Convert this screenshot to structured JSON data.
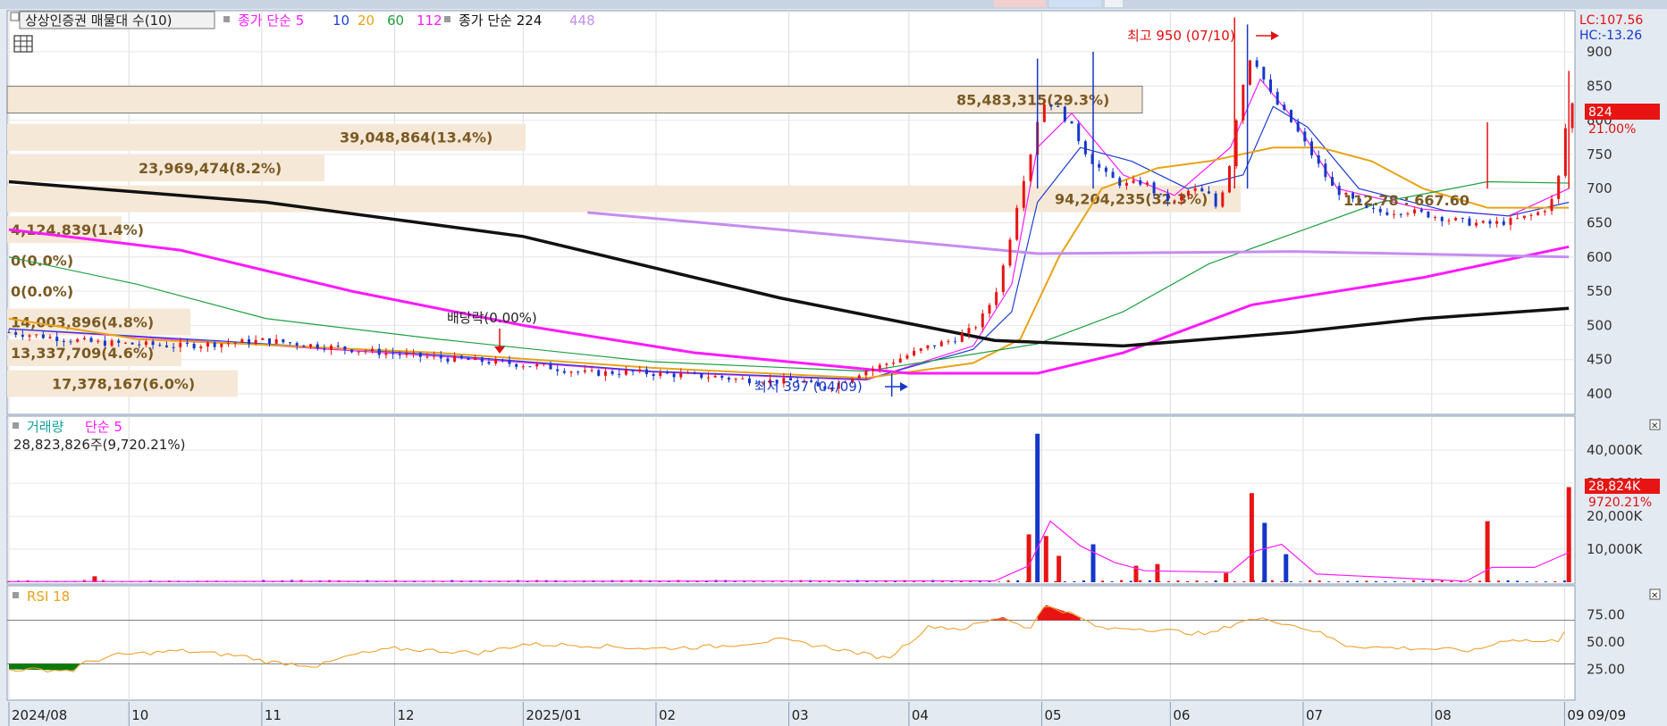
{
  "main_panel": {
    "indicator_title": "상상인증권 매물대 수(10)",
    "ma_label": "종가 단순 5",
    "ma_periods": [
      {
        "text": "10",
        "color": "#1f3fd6"
      },
      {
        "text": "20",
        "color": "#e8a317"
      },
      {
        "text": "60",
        "color": "#20a040"
      },
      {
        "text": "112",
        "color": "#ff1aff"
      }
    ],
    "ma2_label": "종가 단순 224",
    "ma2_period": "448",
    "high_marker": "최고 950 (07/10)",
    "low_marker": "최저 397 (04/09)",
    "dividend_marker": "배당락(0.00%)",
    "lc_label": "LC:107.56",
    "hc_label": "HC:-13.26",
    "current_price": "824",
    "current_change": "21.00%"
  },
  "volume_profile": [
    {
      "label": "85,483,315(29.3%)",
      "price": 830,
      "width": 1270,
      "highlight": true
    },
    {
      "label": "39,048,864(13.4%)",
      "price": 775,
      "width": 580
    },
    {
      "label": "23,969,474(8.2%)",
      "price": 730,
      "width": 355
    },
    {
      "label": "94,204,235(32.3%)",
      "price": 685,
      "width": 1380
    },
    {
      "label": "4,124,839(1.4%)",
      "price": 640,
      "width": 128
    },
    {
      "label": "0(0.0%)",
      "price": 595,
      "width": 0
    },
    {
      "label": "0(0.0%)",
      "price": 550,
      "width": 0
    },
    {
      "label": "14,003,896(4.8%)",
      "price": 505,
      "width": 205
    },
    {
      "label": "13,337,709(4.6%)",
      "price": 460,
      "width": 195
    },
    {
      "label": "17,378,167(6.0%)",
      "price": 415,
      "width": 258
    }
  ],
  "overlay_label": "112.78 : 667.60",
  "volume_panel": {
    "title": "거래량",
    "ma_label": "단순 5",
    "value_text": "28,823,826주(9,720.21%)",
    "current_volume": "28,824K",
    "current_change": "9720.21%"
  },
  "rsi_panel": {
    "title": "RSI 18"
  },
  "x_axis": {
    "labels": [
      "2024/08",
      "10",
      "11",
      "12",
      "2025/01",
      "02",
      "03",
      "04",
      "05",
      "06",
      "07",
      "08",
      "09",
      "09/09"
    ]
  },
  "chart_data": [
    {
      "type": "candlestick",
      "y_ticks": [
        "400",
        "450",
        "500",
        "550",
        "600",
        "650",
        "700",
        "750",
        "800",
        "850",
        "900"
      ],
      "ylim": [
        370,
        960
      ],
      "months": [
        "2024/08",
        "10",
        "11",
        "12",
        "2025/01",
        "02",
        "03",
        "04",
        "05",
        "06",
        "07",
        "08",
        "09"
      ],
      "close_path": [
        [
          0,
          490
        ],
        [
          20,
          475
        ],
        [
          40,
          470
        ],
        [
          60,
          478
        ],
        [
          80,
          465
        ],
        [
          95,
          455
        ],
        [
          110,
          448
        ],
        [
          125,
          440
        ],
        [
          135,
          430
        ],
        [
          145,
          432
        ],
        [
          155,
          428
        ],
        [
          165,
          425
        ],
        [
          170,
          421
        ],
        [
          175,
          420
        ],
        [
          180,
          418
        ],
        [
          185,
          420
        ],
        [
          188,
          410
        ],
        [
          190,
          408
        ],
        [
          193,
          414
        ],
        [
          198,
          430
        ],
        [
          203,
          440
        ],
        [
          208,
          452
        ],
        [
          212,
          462
        ],
        [
          215,
          470
        ],
        [
          220,
          478
        ],
        [
          225,
          495
        ],
        [
          228,
          520
        ],
        [
          231,
          560
        ],
        [
          234,
          640
        ],
        [
          236,
          700
        ],
        [
          238,
          740
        ],
        [
          240,
          800
        ],
        [
          242,
          830
        ],
        [
          245,
          815
        ],
        [
          248,
          790
        ],
        [
          252,
          745
        ],
        [
          256,
          720
        ],
        [
          260,
          705
        ],
        [
          265,
          710
        ],
        [
          268,
          690
        ],
        [
          272,
          680
        ],
        [
          276,
          700
        ],
        [
          280,
          690
        ],
        [
          282,
          670
        ],
        [
          285,
          740
        ],
        [
          287,
          830
        ],
        [
          290,
          900
        ],
        [
          292,
          870
        ],
        [
          295,
          830
        ],
        [
          298,
          808
        ],
        [
          300,
          790
        ],
        [
          303,
          760
        ],
        [
          306,
          730
        ],
        [
          309,
          700
        ],
        [
          313,
          685
        ],
        [
          317,
          668
        ],
        [
          321,
          665
        ],
        [
          326,
          668
        ],
        [
          331,
          662
        ],
        [
          336,
          655
        ],
        [
          341,
          650
        ],
        [
          345,
          648
        ],
        [
          350,
          652
        ],
        [
          355,
          660
        ],
        [
          358,
          668
        ],
        [
          361,
          690
        ],
        [
          364,
          824
        ]
      ],
      "high": {
        "value": 950,
        "date": "07/10"
      },
      "low": {
        "value": 397,
        "date": "04/09"
      },
      "ma_series": [
        {
          "name": "5",
          "color": "#ff1aff",
          "path": [
            [
              0,
              495
            ],
            [
              50,
              475
            ],
            [
              100,
              455
            ],
            [
              150,
              432
            ],
            [
              200,
              420
            ],
            [
              225,
              470
            ],
            [
              234,
              560
            ],
            [
              240,
              760
            ],
            [
              248,
              810
            ],
            [
              260,
              720
            ],
            [
              272,
              690
            ],
            [
              285,
              760
            ],
            [
              292,
              860
            ],
            [
              300,
              800
            ],
            [
              310,
              700
            ],
            [
              330,
              670
            ],
            [
              350,
              660
            ],
            [
              364,
              700
            ]
          ]
        },
        {
          "name": "10",
          "color": "#1f3fd6",
          "path": [
            [
              0,
              495
            ],
            [
              50,
              477
            ],
            [
              100,
              457
            ],
            [
              150,
              433
            ],
            [
              200,
              421
            ],
            [
              225,
              465
            ],
            [
              234,
              520
            ],
            [
              240,
              680
            ],
            [
              250,
              760
            ],
            [
              262,
              740
            ],
            [
              275,
              700
            ],
            [
              288,
              720
            ],
            [
              295,
              820
            ],
            [
              303,
              790
            ],
            [
              315,
              700
            ],
            [
              335,
              668
            ],
            [
              350,
              660
            ],
            [
              364,
              680
            ]
          ]
        },
        {
          "name": "20",
          "color": "#e8a317",
          "path": [
            [
              0,
              510
            ],
            [
              30,
              480
            ],
            [
              100,
              460
            ],
            [
              150,
              438
            ],
            [
              200,
              423
            ],
            [
              225,
              445
            ],
            [
              236,
              480
            ],
            [
              245,
              600
            ],
            [
              255,
              700
            ],
            [
              268,
              730
            ],
            [
              280,
              740
            ],
            [
              295,
              760
            ],
            [
              306,
              760
            ],
            [
              318,
              740
            ],
            [
              330,
              700
            ],
            [
              345,
              672
            ],
            [
              364,
              672
            ]
          ]
        },
        {
          "name": "60",
          "color": "#20a040",
          "path": [
            [
              0,
              600
            ],
            [
              30,
              560
            ],
            [
              60,
              510
            ],
            [
              100,
              480
            ],
            [
              150,
              447
            ],
            [
              200,
              433
            ],
            [
              240,
              473
            ],
            [
              260,
              520
            ],
            [
              280,
              590
            ],
            [
              300,
              635
            ],
            [
              320,
              680
            ],
            [
              345,
              710
            ],
            [
              364,
              708
            ]
          ]
        },
        {
          "name": "112",
          "color": "#ff1aff",
          "path": [
            [
              0,
              640
            ],
            [
              40,
              610
            ],
            [
              80,
              550
            ],
            [
              120,
              500
            ],
            [
              160,
              460
            ],
            [
              210,
              430
            ],
            [
              240,
              430
            ],
            [
              260,
              460
            ],
            [
              290,
              530
            ],
            [
              330,
              570
            ],
            [
              364,
              615
            ]
          ]
        },
        {
          "name": "224",
          "color": "#111111",
          "path": [
            [
              0,
              710
            ],
            [
              60,
              680
            ],
            [
              120,
              630
            ],
            [
              180,
              540
            ],
            [
              230,
              478
            ],
            [
              260,
              470
            ],
            [
              300,
              490
            ],
            [
              330,
              510
            ],
            [
              364,
              525
            ]
          ]
        },
        {
          "name": "448",
          "color": "#c58cf0",
          "path": [
            [
              135,
              665
            ],
            [
              180,
              640
            ],
            [
              240,
              605
            ],
            [
              300,
              608
            ],
            [
              364,
              600
            ]
          ]
        }
      ]
    },
    {
      "type": "bar",
      "name": "거래량",
      "y_ticks": [
        "10,000K",
        "20,000K",
        "30,000K",
        "40,000K"
      ],
      "ylim": [
        0,
        46000
      ],
      "bars": [
        [
          20,
          1800,
          "up"
        ],
        [
          238,
          14500,
          "up"
        ],
        [
          240,
          45000,
          "down"
        ],
        [
          242,
          14000,
          "up"
        ],
        [
          245,
          8000,
          "up"
        ],
        [
          253,
          11500,
          "down"
        ],
        [
          263,
          5000,
          "up"
        ],
        [
          268,
          5500,
          "up"
        ],
        [
          284,
          2800,
          "up"
        ],
        [
          290,
          27000,
          "up"
        ],
        [
          293,
          18000,
          "down"
        ],
        [
          298,
          8500,
          "down"
        ],
        [
          345,
          18500,
          "up"
        ],
        [
          364,
          28824,
          "up"
        ]
      ],
      "ma5_path": [
        [
          0,
          200
        ],
        [
          230,
          400
        ],
        [
          238,
          5000
        ],
        [
          243,
          18500
        ],
        [
          250,
          11000
        ],
        [
          258,
          6000
        ],
        [
          265,
          3500
        ],
        [
          285,
          3000
        ],
        [
          291,
          9500
        ],
        [
          297,
          11500
        ],
        [
          305,
          2500
        ],
        [
          340,
          300
        ],
        [
          346,
          4500
        ],
        [
          356,
          4500
        ],
        [
          364,
          9000
        ]
      ]
    },
    {
      "type": "line",
      "name": "RSI 18",
      "y_ticks": [
        "25.00",
        "50.00",
        "75.00"
      ],
      "ylim": [
        0,
        100
      ],
      "upper": 70,
      "lower": 30,
      "path": [
        [
          0,
          25
        ],
        [
          15,
          24
        ],
        [
          17,
          30
        ],
        [
          25,
          38
        ],
        [
          40,
          42
        ],
        [
          55,
          37
        ],
        [
          60,
          32
        ],
        [
          72,
          28
        ],
        [
          80,
          38
        ],
        [
          90,
          44
        ],
        [
          100,
          42
        ],
        [
          110,
          40
        ],
        [
          120,
          48
        ],
        [
          135,
          47
        ],
        [
          150,
          44
        ],
        [
          165,
          46
        ],
        [
          180,
          52
        ],
        [
          190,
          46
        ],
        [
          205,
          35
        ],
        [
          215,
          65
        ],
        [
          222,
          62
        ],
        [
          232,
          73
        ],
        [
          238,
          62
        ],
        [
          242,
          84
        ],
        [
          248,
          76
        ],
        [
          255,
          62
        ],
        [
          262,
          63
        ],
        [
          272,
          60
        ],
        [
          280,
          57
        ],
        [
          288,
          70
        ],
        [
          294,
          71
        ],
        [
          305,
          60
        ],
        [
          312,
          47
        ],
        [
          320,
          45
        ],
        [
          330,
          44
        ],
        [
          342,
          42
        ],
        [
          350,
          53
        ],
        [
          358,
          50
        ],
        [
          362,
          52
        ],
        [
          364,
          70
        ]
      ]
    }
  ]
}
